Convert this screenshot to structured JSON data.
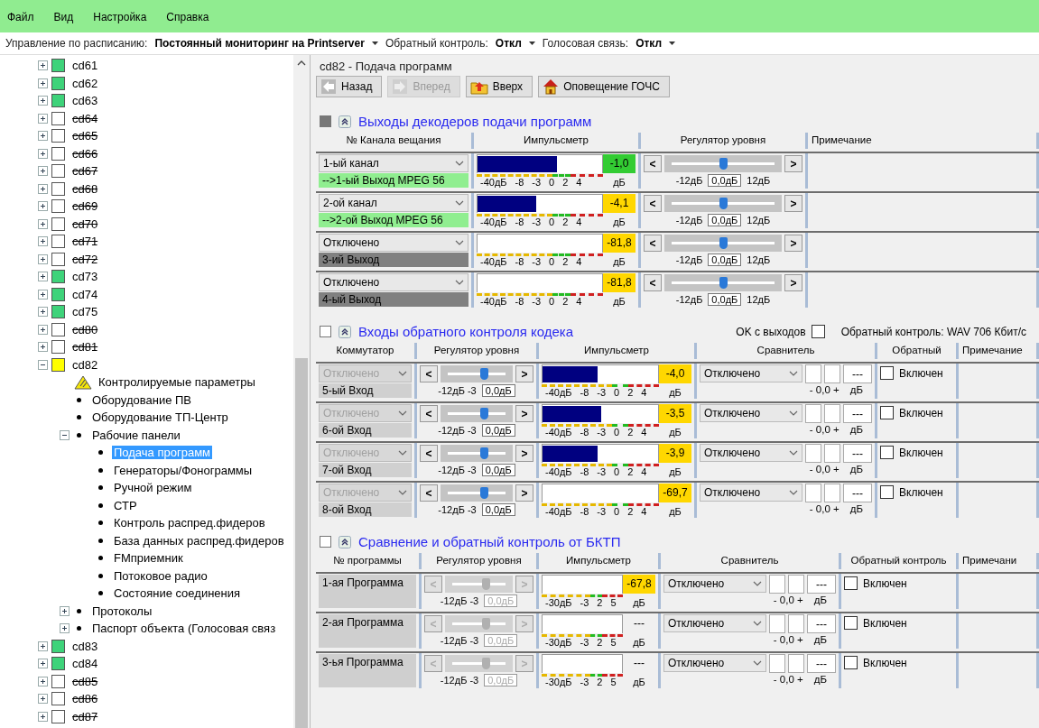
{
  "menu": [
    "Файл",
    "Вид",
    "Настройка",
    "Справка"
  ],
  "toolbar": [
    {
      "label": "Управление по расписанию:",
      "value": "Постоянный мониторинг на Printserver"
    },
    {
      "label": "Обратный контроль:",
      "value": "Откл"
    },
    {
      "label": "Голосовая связь:",
      "value": "Откл"
    }
  ],
  "tree": {
    "items": [
      {
        "kind": "station",
        "label": "cd61",
        "color": "#3ed37a",
        "offline": false,
        "expanded": false,
        "selected": false
      },
      {
        "kind": "station",
        "label": "cd62",
        "color": "#3ed37a",
        "offline": false,
        "expanded": false,
        "selected": false
      },
      {
        "kind": "station",
        "label": "cd63",
        "color": "#3ed37a",
        "offline": false,
        "expanded": false,
        "selected": false
      },
      {
        "kind": "station",
        "label": "cd64",
        "color": "#ffffff",
        "offline": true,
        "expanded": false,
        "selected": false
      },
      {
        "kind": "station",
        "label": "cd65",
        "color": "#ffffff",
        "offline": true,
        "expanded": false,
        "selected": false
      },
      {
        "kind": "station",
        "label": "cd66",
        "color": "#ffffff",
        "offline": true,
        "expanded": false,
        "selected": false
      },
      {
        "kind": "station",
        "label": "cd67",
        "color": "#ffffff",
        "offline": true,
        "expanded": false,
        "selected": false
      },
      {
        "kind": "station",
        "label": "cd68",
        "color": "#ffffff",
        "offline": true,
        "expanded": false,
        "selected": false
      },
      {
        "kind": "station",
        "label": "cd69",
        "color": "#ffffff",
        "offline": true,
        "expanded": false,
        "selected": false
      },
      {
        "kind": "station",
        "label": "cd70",
        "color": "#ffffff",
        "offline": true,
        "expanded": false,
        "selected": false
      },
      {
        "kind": "station",
        "label": "cd71",
        "color": "#ffffff",
        "offline": true,
        "expanded": false,
        "selected": false
      },
      {
        "kind": "station",
        "label": "cd72",
        "color": "#ffffff",
        "offline": true,
        "expanded": false,
        "selected": false
      },
      {
        "kind": "station",
        "label": "cd73",
        "color": "#3ed37a",
        "offline": false,
        "expanded": false,
        "selected": false
      },
      {
        "kind": "station",
        "label": "cd74",
        "color": "#3ed37a",
        "offline": false,
        "expanded": false,
        "selected": false
      },
      {
        "kind": "station",
        "label": "cd75",
        "color": "#3ed37a",
        "offline": false,
        "expanded": false,
        "selected": false
      },
      {
        "kind": "station",
        "label": "cd80",
        "color": "#ffffff",
        "offline": true,
        "expanded": false,
        "selected": false
      },
      {
        "kind": "station",
        "label": "cd81",
        "color": "#ffffff",
        "offline": true,
        "expanded": false,
        "selected": false
      },
      {
        "kind": "station",
        "label": "cd82",
        "color": "#ffff00",
        "offline": false,
        "expanded": true,
        "selected": false,
        "children": [
          {
            "kind": "warning",
            "label": "Контролируемые параметры",
            "selected": false
          },
          {
            "kind": "bullet",
            "label": "Оборудование ПВ",
            "selected": false
          },
          {
            "kind": "bullet",
            "label": "Оборудование ТП-Центр",
            "selected": false
          },
          {
            "kind": "bullet",
            "label": "Рабочие панели",
            "expanded": true,
            "selected": false,
            "children": [
              {
                "kind": "bullet",
                "label": "Подача программ",
                "selected": true
              },
              {
                "kind": "bullet",
                "label": "Генераторы/Фонограммы",
                "selected": false
              },
              {
                "kind": "bullet",
                "label": "Ручной режим",
                "selected": false
              },
              {
                "kind": "bullet",
                "label": "СТР",
                "selected": false
              },
              {
                "kind": "bullet",
                "label": "Контроль распред.фидеров",
                "selected": false
              },
              {
                "kind": "bullet",
                "label": "База данных распред.фидеров",
                "selected": false
              },
              {
                "kind": "bullet",
                "label": "FMприемник",
                "selected": false
              },
              {
                "kind": "bullet",
                "label": "Потоковое радио",
                "selected": false
              },
              {
                "kind": "bullet",
                "label": "Состояние соединения",
                "selected": false
              }
            ]
          },
          {
            "kind": "bullet",
            "label": "Протоколы",
            "expanded": false,
            "selected": false
          },
          {
            "kind": "bullet",
            "label": "Паспорт объекта (Голосовая связ",
            "expanded": false,
            "selected": false
          }
        ]
      },
      {
        "kind": "station",
        "label": "cd83",
        "color": "#3ed37a",
        "offline": false,
        "expanded": false,
        "selected": false
      },
      {
        "kind": "station",
        "label": "cd84",
        "color": "#3ed37a",
        "offline": false,
        "expanded": false,
        "selected": false
      },
      {
        "kind": "station",
        "label": "cd85",
        "color": "#ffffff",
        "offline": true,
        "expanded": false,
        "selected": false
      },
      {
        "kind": "station",
        "label": "cd86",
        "color": "#ffffff",
        "offline": true,
        "expanded": false,
        "selected": false
      },
      {
        "kind": "station",
        "label": "cd87",
        "color": "#ffffff",
        "offline": true,
        "expanded": false,
        "selected": false
      }
    ]
  },
  "title": "cd82 - Подача программ",
  "nav": [
    {
      "kind": "back",
      "label": "Назад",
      "disabled": false
    },
    {
      "kind": "forward",
      "label": "Вперед",
      "disabled": true
    },
    {
      "kind": "up",
      "label": "Вверх",
      "disabled": false
    },
    {
      "kind": "alert",
      "label": "Оповещение ГОЧС",
      "disabled": false
    }
  ],
  "sections": [
    {
      "kind": "decoder",
      "title": "Выходы декодеров подачи программ",
      "checked": true,
      "columns": [
        "№ Канала вещания",
        "Импульсметр",
        "Регулятор уровня",
        "Примечание"
      ],
      "rows": [
        {
          "source": "1-ый канал",
          "output": "-->1-ый Выход  MPEG 56",
          "active": true,
          "meter": {
            "level": 0.64,
            "reading": "-1,0",
            "color": "#33cc33",
            "scale": [
              "-40дБ",
              "-8",
              "-3",
              "0",
              "2",
              "4"
            ],
            "unit": "дБ"
          },
          "slider": {
            "left": "<",
            "right": ">",
            "level": 0.5,
            "min": "-12дБ",
            "value": "0,0дБ",
            "max": "12дБ",
            "disabled": false
          }
        },
        {
          "source": "2-ой канал",
          "output": "-->2-ой Выход  MPEG 56",
          "active": true,
          "meter": {
            "level": 0.47,
            "reading": "-4,1",
            "color": "#ffd700",
            "scale": [
              "-40дБ",
              "-8",
              "-3",
              "0",
              "2",
              "4"
            ],
            "unit": "дБ"
          },
          "slider": {
            "left": "<",
            "right": ">",
            "level": 0.5,
            "min": "-12дБ",
            "value": "0,0дБ",
            "max": "12дБ",
            "disabled": false
          }
        },
        {
          "source": "Отключено",
          "output": "3-ий Выход",
          "active": false,
          "meter": {
            "level": 0,
            "reading": "-81,8",
            "color": "#ffd700",
            "scale": [
              "-40дБ",
              "-8",
              "-3",
              "0",
              "2",
              "4"
            ],
            "unit": "дБ"
          },
          "slider": {
            "left": "<",
            "right": ">",
            "level": 0.5,
            "min": "-12дБ",
            "value": "0,0дБ",
            "max": "12дБ",
            "disabled": false
          }
        },
        {
          "source": "Отключено",
          "output": "4-ый Выход",
          "active": false,
          "meter": {
            "level": 0,
            "reading": "-81,8",
            "color": "#ffd700",
            "scale": [
              "-40дБ",
              "-8",
              "-3",
              "0",
              "2",
              "4"
            ],
            "unit": "дБ"
          },
          "slider": {
            "left": "<",
            "right": ">",
            "level": 0.5,
            "min": "-12дБ",
            "value": "0,0дБ",
            "max": "12дБ",
            "disabled": false
          }
        }
      ]
    },
    {
      "kind": "codec",
      "title": "Входы обратного контроля кодека",
      "checked": false,
      "option": {
        "label": "OK с выходов",
        "checked": false
      },
      "info": "Обратный контроль: WAV 706 Кбит/с",
      "columns": [
        "Коммутатор",
        "Регулятор уровня",
        "Импульсметр",
        "Сравнитель",
        "Обратный",
        "Примечание"
      ],
      "rows": [
        {
          "source": "Отключено",
          "source_disabled": true,
          "label": "5-ый Вход",
          "slider": {
            "left": "<",
            "right": ">",
            "level": 0.6,
            "min": "-12дБ -3",
            "value": "0,0дБ",
            "disabled": false
          },
          "meter": {
            "level": 0.48,
            "reading": "-4,0",
            "color": "#ffd700",
            "scale": [
              "-40дБ",
              "-8",
              "-3",
              "0",
              "2",
              "4"
            ],
            "unit": "дБ"
          },
          "comparator": {
            "mode": "Отключено",
            "value": "---",
            "offset": "- 0,0 +",
            "unit": "дБ"
          },
          "return": {
            "label": "Включен",
            "checked": false
          }
        },
        {
          "source": "Отключено",
          "source_disabled": true,
          "label": "6-ой Вход",
          "slider": {
            "left": "<",
            "right": ">",
            "level": 0.6,
            "min": "-12дБ -3",
            "value": "0,0дБ",
            "disabled": false
          },
          "meter": {
            "level": 0.51,
            "reading": "-3,5",
            "color": "#ffd700",
            "scale": [
              "-40дБ",
              "-8",
              "-3",
              "0",
              "2",
              "4"
            ],
            "unit": "дБ"
          },
          "comparator": {
            "mode": "Отключено",
            "value": "---",
            "offset": "- 0,0 +",
            "unit": "дБ"
          },
          "return": {
            "label": "Включен",
            "checked": false
          }
        },
        {
          "source": "Отключено",
          "source_disabled": true,
          "label": "7-ой Вход",
          "slider": {
            "left": "<",
            "right": ">",
            "level": 0.6,
            "min": "-12дБ -3",
            "value": "0,0дБ",
            "disabled": false
          },
          "meter": {
            "level": 0.48,
            "reading": "-3,9",
            "color": "#ffd700",
            "scale": [
              "-40дБ",
              "-8",
              "-3",
              "0",
              "2",
              "4"
            ],
            "unit": "дБ"
          },
          "comparator": {
            "mode": "Отключено",
            "value": "---",
            "offset": "- 0,0 +",
            "unit": "дБ"
          },
          "return": {
            "label": "Включен",
            "checked": false
          }
        },
        {
          "source": "Отключено",
          "source_disabled": true,
          "label": "8-ой Вход",
          "slider": {
            "left": "<",
            "right": ">",
            "level": 0.6,
            "min": "-12дБ -3",
            "value": "0,0дБ",
            "disabled": false
          },
          "meter": {
            "level": 0,
            "reading": "-69,7",
            "color": "#ffd700",
            "scale": [
              "-40дБ",
              "-8",
              "-3",
              "0",
              "2",
              "4"
            ],
            "unit": "дБ"
          },
          "comparator": {
            "mode": "Отключено",
            "value": "---",
            "offset": "- 0,0 +",
            "unit": "дБ"
          },
          "return": {
            "label": "Включен",
            "checked": false
          }
        }
      ]
    },
    {
      "kind": "bktp",
      "title": "Сравнение и обратный контроль от БКТП",
      "checked": false,
      "columns": [
        "№ программы",
        "Регулятор уровня",
        "Импульсметр",
        "Сравнитель",
        "Обратный контроль",
        "Примечани"
      ],
      "rows": [
        {
          "label": "1-ая Программа",
          "slider": {
            "left": "<",
            "right": ">",
            "level": 0.6,
            "min": "-12дБ -3",
            "value": "0,0дБ",
            "disabled": true
          },
          "meter": {
            "level": 0,
            "reading": "-67,8",
            "color": "#ffd700",
            "scale": [
              "-30дБ",
              "-3",
              "2",
              "5"
            ],
            "unit": "дБ"
          },
          "comparator": {
            "mode": "Отключено",
            "value": "---",
            "offset": "- 0,0 +",
            "unit": "дБ"
          },
          "return": {
            "label": "Включен",
            "checked": false
          }
        },
        {
          "label": "2-ая Программа",
          "slider": {
            "left": "<",
            "right": ">",
            "level": 0.6,
            "min": "-12дБ -3",
            "value": "0,0дБ",
            "disabled": true
          },
          "meter": {
            "level": 0,
            "reading": "---",
            "scale": [
              "-30дБ",
              "-3",
              "2",
              "5"
            ],
            "unit": "дБ"
          },
          "comparator": {
            "mode": "Отключено",
            "value": "---",
            "offset": "- 0,0 +",
            "unit": "дБ"
          },
          "return": {
            "label": "Включен",
            "checked": false
          }
        },
        {
          "label": "3-ья Программа",
          "slider": {
            "left": "<",
            "right": ">",
            "level": 0.6,
            "min": "-12дБ -3",
            "value": "0,0дБ",
            "disabled": true
          },
          "meter": {
            "level": 0,
            "reading": "---",
            "scale": [
              "-30дБ",
              "-3",
              "2",
              "5"
            ],
            "unit": "дБ"
          },
          "comparator": {
            "mode": "Отключено",
            "value": "---",
            "offset": "- 0,0 +",
            "unit": "дБ"
          },
          "return": {
            "label": "Включен",
            "checked": false
          }
        }
      ]
    }
  ]
}
